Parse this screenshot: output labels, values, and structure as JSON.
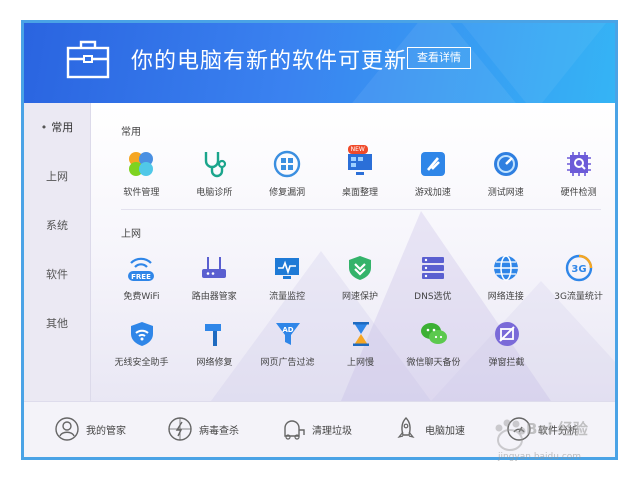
{
  "banner": {
    "title": "你的电脑有新的软件可更新",
    "detail_button": "查看详情"
  },
  "sidebar": {
    "items": [
      {
        "label": "常用",
        "active": true
      },
      {
        "label": "上网"
      },
      {
        "label": "系统"
      },
      {
        "label": "软件"
      },
      {
        "label": "其他"
      }
    ]
  },
  "sections": [
    {
      "title": "常用",
      "items": [
        {
          "label": "软件管理",
          "icon": "software-manager-icon"
        },
        {
          "label": "电脑诊所",
          "icon": "stethoscope-icon"
        },
        {
          "label": "修复漏洞",
          "icon": "windows-repair-icon"
        },
        {
          "label": "桌面整理",
          "icon": "desktop-organize-icon",
          "badge": "NEW"
        },
        {
          "label": "游戏加速",
          "icon": "game-boost-icon"
        },
        {
          "label": "测试网速",
          "icon": "speedometer-icon"
        },
        {
          "label": "硬件检测",
          "icon": "chip-scan-icon"
        }
      ]
    },
    {
      "title": "上网",
      "items": [
        {
          "label": "免费WiFi",
          "icon": "free-wifi-icon",
          "badge": "FREE"
        },
        {
          "label": "路由器管家",
          "icon": "router-icon"
        },
        {
          "label": "流量监控",
          "icon": "traffic-monitor-icon"
        },
        {
          "label": "网速保护",
          "icon": "shield-check-icon"
        },
        {
          "label": "DNS选优",
          "icon": "dns-server-icon"
        },
        {
          "label": "网络连接",
          "icon": "globe-icon"
        },
        {
          "label": "3G流量统计",
          "icon": "3g-icon",
          "icon_text": "3G"
        }
      ]
    },
    {
      "title": "",
      "items": [
        {
          "label": "无线安全助手",
          "icon": "wifi-shield-icon"
        },
        {
          "label": "网络修复",
          "icon": "hammer-icon"
        },
        {
          "label": "网页广告过滤",
          "icon": "ad-filter-icon",
          "icon_text": "AD"
        },
        {
          "label": "上网慢",
          "icon": "hourglass-icon"
        },
        {
          "label": "微信聊天备份",
          "icon": "wechat-icon"
        },
        {
          "label": "弹窗拦截",
          "icon": "popup-block-icon"
        }
      ]
    }
  ],
  "bottom": {
    "items": [
      {
        "label": "我的管家",
        "icon": "butler-icon"
      },
      {
        "label": "病毒查杀",
        "icon": "virus-scan-icon"
      },
      {
        "label": "清理垃圾",
        "icon": "vacuum-icon"
      },
      {
        "label": "电脑加速",
        "icon": "rocket-icon"
      },
      {
        "label": "软件分析",
        "icon": "software-analysis-icon"
      }
    ]
  },
  "watermark": {
    "text": "Bai 经验",
    "url": "jingyan.baidu.com"
  },
  "colors": {
    "banner_start": "#2a64e0",
    "banner_end": "#35b4f5",
    "frame": "#4aa3e6",
    "badge_red": "#f04a2a"
  }
}
